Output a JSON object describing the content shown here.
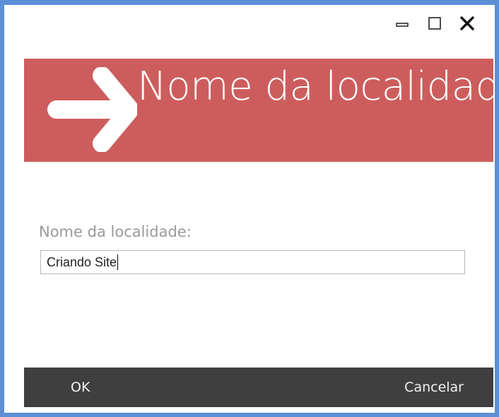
{
  "window": {
    "minimize_icon": "minimize-icon",
    "maximize_icon": "maximize-icon",
    "close_icon": "close-icon"
  },
  "banner": {
    "title": "Nome da localidade",
    "icon": "arrow-right-icon",
    "background_color": "#cd5d5d"
  },
  "form": {
    "label": "Nome da localidade:",
    "input_value": "Criando Site"
  },
  "footer": {
    "ok_label": "OK",
    "cancel_label": "Cancelar",
    "background_color": "#3f3f3f"
  },
  "colors": {
    "window_border": "#5b8fd6",
    "label_text": "#9a9a9a"
  }
}
